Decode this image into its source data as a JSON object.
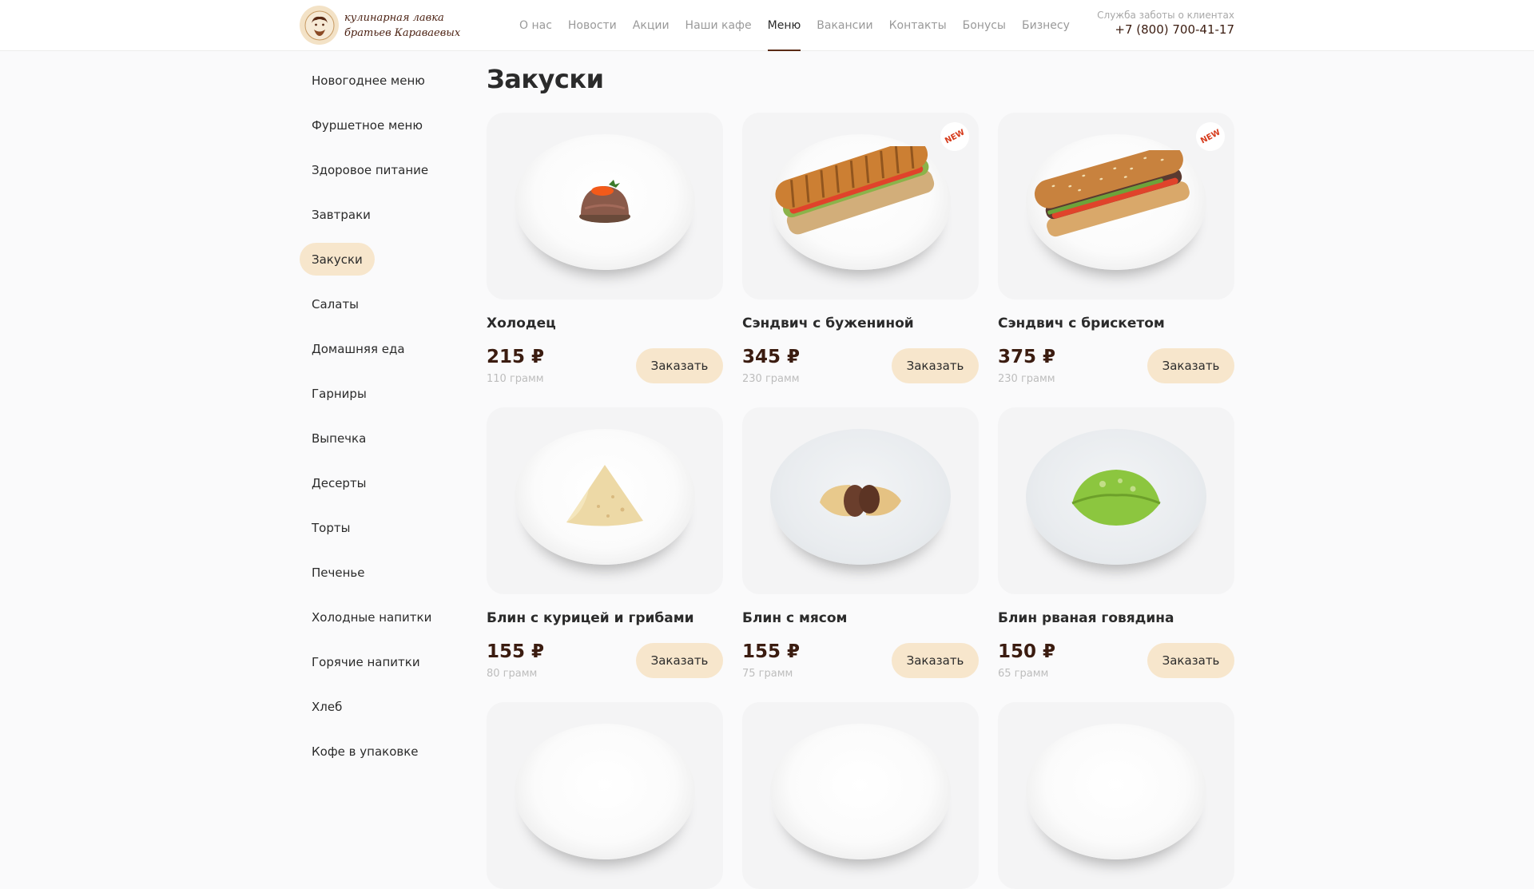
{
  "header": {
    "logo_line1": "кулинарная лавка",
    "logo_line2": "братьев Караваевых",
    "nav": [
      "О нас",
      "Новости",
      "Акции",
      "Наши кафе",
      "Меню",
      "Вакансии",
      "Контакты",
      "Бонусы",
      "Бизнесу"
    ],
    "nav_active": "Меню",
    "support_label": "Служба заботы о клиентах",
    "support_phone": "+7 (800) 700-41-17"
  },
  "sidebar": {
    "items": [
      "Новогоднее меню",
      "Фуршетное меню",
      "Здоровое питание",
      "Завтраки",
      "Закуски",
      "Салаты",
      "Домашняя еда",
      "Гарниры",
      "Выпечка",
      "Десерты",
      "Торты",
      "Печенье",
      "Холодные напитки",
      "Горячие напитки",
      "Хлеб",
      "Кофе в упаковке"
    ],
    "active": "Закуски"
  },
  "main": {
    "title": "Закуски",
    "order_label": "Заказать",
    "new_label": "NEW",
    "products": [
      {
        "name": "Холодец",
        "price": "215 ₽",
        "weight": "110 грамм",
        "is_new": false,
        "dish": "aspic"
      },
      {
        "name": "Сэндвич с бужениной",
        "price": "345 ₽",
        "weight": "230 грамм",
        "is_new": true,
        "dish": "sandwich-grilled"
      },
      {
        "name": "Сэндвич с брискетом",
        "price": "375 ₽",
        "weight": "230 грамм",
        "is_new": true,
        "dish": "sandwich-sesame"
      },
      {
        "name": "Блин с курицей и грибами",
        "price": "155 ₽",
        "weight": "80 грамм",
        "is_new": false,
        "dish": "crepe-triangle"
      },
      {
        "name": "Блин с мясом",
        "price": "155 ₽",
        "weight": "75 грамм",
        "is_new": false,
        "dish": "crepe-roll"
      },
      {
        "name": "Блин рваная говядина",
        "price": "150 ₽",
        "weight": "65 грамм",
        "is_new": false,
        "dish": "green-dumpling"
      }
    ]
  },
  "colors": {
    "accent_bg": "#f7e6cc",
    "brand_dark": "#3b1c10",
    "new_badge": "#d63b1c"
  }
}
